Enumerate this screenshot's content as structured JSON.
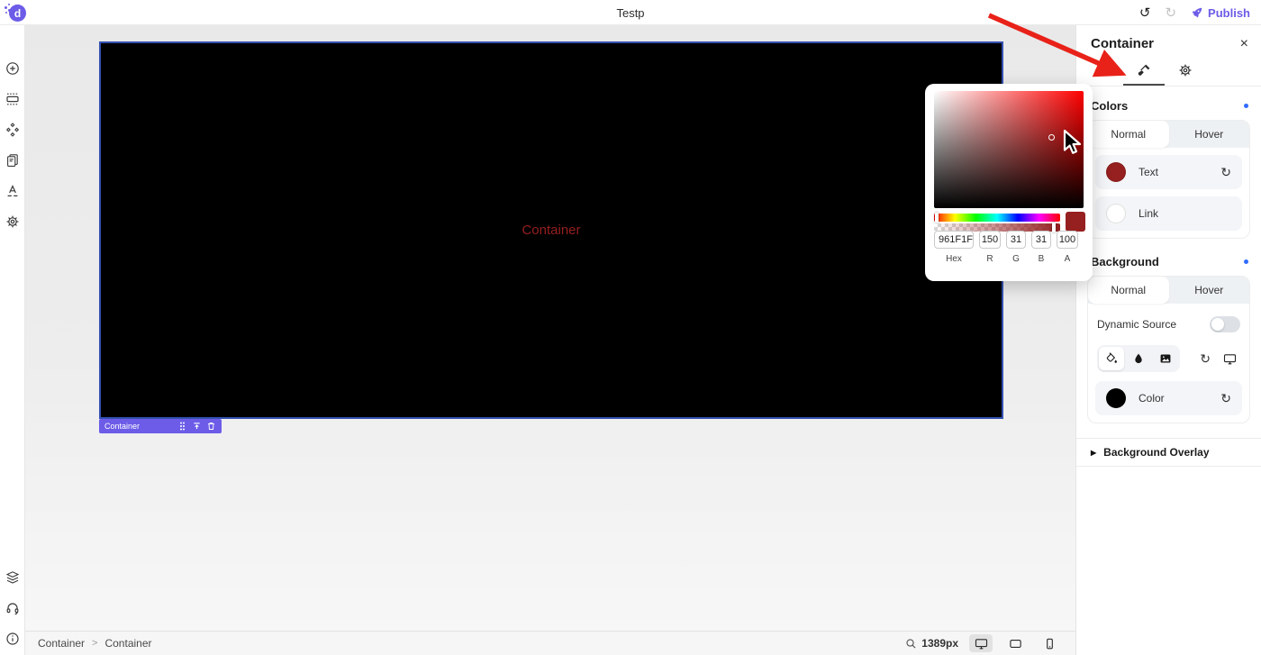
{
  "topbar": {
    "title": "Testp",
    "publish_label": "Publish"
  },
  "icons": {
    "undo": "↺",
    "redo": "↻",
    "close": "×",
    "reset": "↻",
    "expand_triangle": "▶",
    "breadcrumb_separator": ">"
  },
  "canvas": {
    "container_text": "Container",
    "container_text_color": "#961F1F",
    "container_background": "#000000",
    "badge_label": "Container"
  },
  "right_panel": {
    "title": "Container",
    "colors": {
      "heading": "Colors",
      "tab_normal": "Normal",
      "tab_hover": "Hover",
      "text_label": "Text",
      "text_swatch": "#961F1F",
      "link_label": "Link",
      "link_swatch": "#FFFFFF"
    },
    "background": {
      "heading": "Background",
      "tab_normal": "Normal",
      "tab_hover": "Hover",
      "dynamic_source_label": "Dynamic Source",
      "color_label": "Color",
      "color_swatch": "#000000"
    },
    "background_overlay_label": "Background Overlay"
  },
  "color_picker": {
    "hex_value": "961F1F",
    "r_value": "150",
    "g_value": "31",
    "b_value": "31",
    "a_value": "100",
    "hex_label": "Hex",
    "r_label": "R",
    "g_label": "G",
    "b_label": "B",
    "a_label": "A",
    "preview_color": "#961F1F"
  },
  "statusbar": {
    "breadcrumb_parent": "Container",
    "breadcrumb_current": "Container",
    "zoom_value": "1389px"
  },
  "theme": {
    "accent_purple": "#6C5CE7",
    "info_dot_blue": "#2F6BFF",
    "annotation_red": "#E82219"
  }
}
